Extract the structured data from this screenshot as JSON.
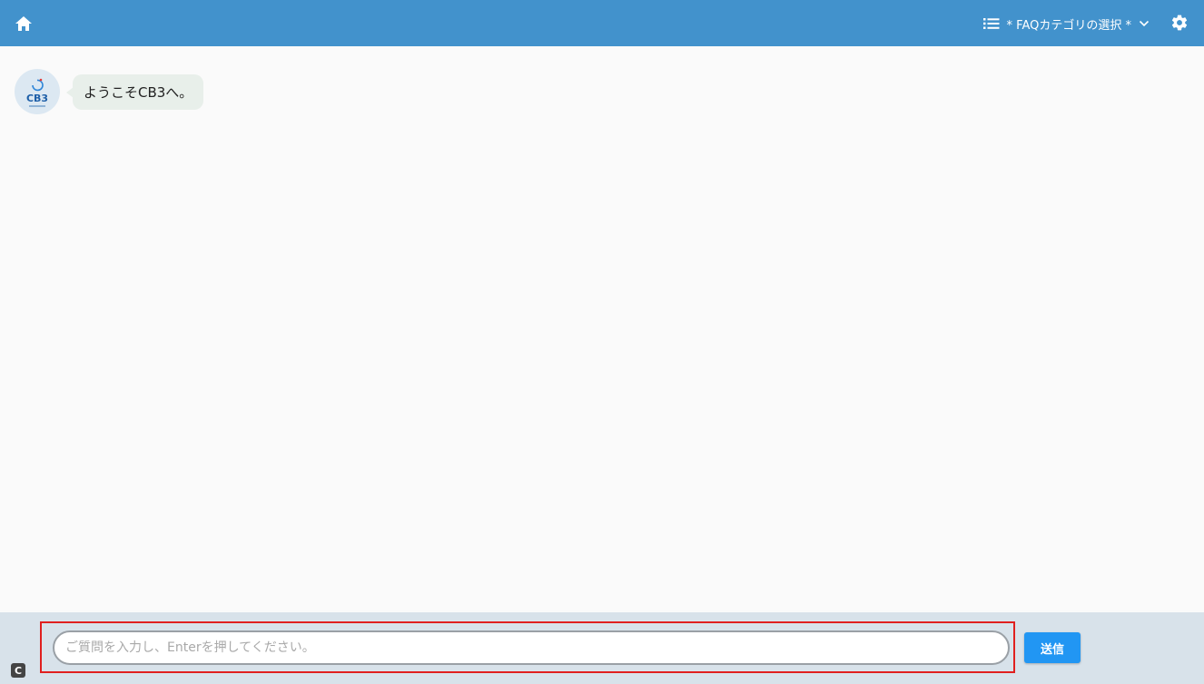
{
  "header": {
    "home_icon": "home-icon",
    "category_icon": "list-icon",
    "category_label": "* FAQカテゴリの選択 *",
    "dropdown_icon": "chevron-down-icon",
    "settings_icon": "gear-icon",
    "background_color": "#4292cc"
  },
  "chat": {
    "messages": [
      {
        "sender": "bot",
        "avatar_text": "CB3",
        "text": "ようこそCB3へ。"
      }
    ]
  },
  "footer": {
    "input_placeholder": "ご質問を入力し、Enterを押してください。",
    "input_value": "",
    "send_label": "送信",
    "send_color": "#2196f3",
    "highlight_color": "#e0201f",
    "corner_logo_text": "C"
  }
}
